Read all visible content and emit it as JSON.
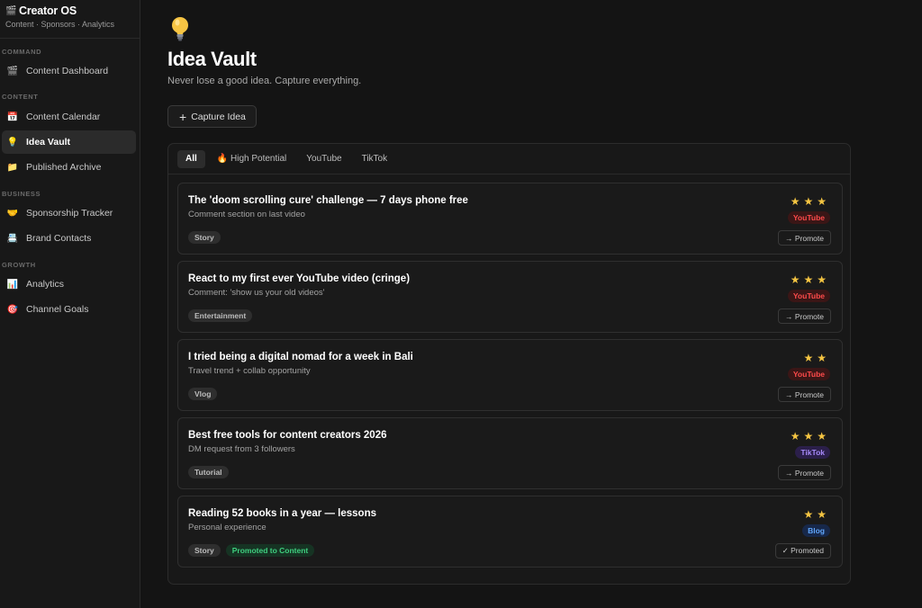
{
  "sidebar": {
    "brand_icon": "clapper-icon",
    "brand_title": "Creator OS",
    "brand_sub": "Content · Sponsors · Analytics",
    "sections": {
      "command": "COMMAND",
      "content": "CONTENT",
      "business": "BUSINESS",
      "growth": "GROWTH"
    },
    "items": [
      {
        "label": "Content Dashboard",
        "icon": "clapper-icon",
        "glyph": "🎬"
      },
      {
        "label": "Content Calendar",
        "icon": "calendar-icon",
        "glyph": "📅"
      },
      {
        "label": "Idea Vault",
        "icon": "lightbulb-icon",
        "glyph": "💡",
        "active": true
      },
      {
        "label": "Published Archive",
        "icon": "folder-icon",
        "glyph": "📁"
      },
      {
        "label": "Sponsorship Tracker",
        "icon": "handshake-icon",
        "glyph": "🤝"
      },
      {
        "label": "Brand Contacts",
        "icon": "contact-card-icon",
        "glyph": "📇"
      },
      {
        "label": "Analytics",
        "icon": "bar-chart-icon",
        "glyph": "📊"
      },
      {
        "label": "Channel Goals",
        "icon": "target-icon",
        "glyph": "🎯"
      }
    ]
  },
  "main": {
    "title": "Idea Vault",
    "subtitle": "Never lose a good idea. Capture everything.",
    "capture_label": "Capture Idea",
    "filters": [
      "All",
      "🔥 High Potential",
      "YouTube",
      "TikTok"
    ],
    "active_filter": "All",
    "ideas": [
      {
        "title": "The 'doom scrolling cure' challenge — 7 days phone free",
        "source": "Comment section on last video",
        "tags": [
          "Story"
        ],
        "rating": 3,
        "stars": "★★★",
        "platform": "YouTube",
        "action": "→ Promote"
      },
      {
        "title": "React to my first ever YouTube video (cringe)",
        "source": "Comment: 'show us your old videos'",
        "tags": [
          "Entertainment"
        ],
        "rating": 3,
        "stars": "★★★",
        "platform": "YouTube",
        "action": "→ Promote"
      },
      {
        "title": "I tried being a digital nomad for a week in Bali",
        "source": "Travel trend + collab opportunity",
        "tags": [
          "Vlog"
        ],
        "rating": 2,
        "stars": "★★",
        "platform": "YouTube",
        "action": "→ Promote"
      },
      {
        "title": "Best free tools for content creators 2026",
        "source": "DM request from 3 followers",
        "tags": [
          "Tutorial"
        ],
        "rating": 3,
        "stars": "★★★",
        "platform": "TikTok",
        "action": "→ Promote"
      },
      {
        "title": "Reading 52 books in a year — lessons",
        "source": "Personal experience",
        "tags": [
          "Story"
        ],
        "status_tag": "Promoted to Content",
        "rating": 2,
        "stars": "★★",
        "platform": "Blog",
        "action": "✓ Promoted"
      }
    ]
  },
  "colors": {
    "youtube_bg": "#3a1616",
    "youtube_fg": "#ff4b4b",
    "tiktok_bg": "#2b1f4a",
    "tiktok_fg": "#a78bfa",
    "blog_bg": "#17284a",
    "blog_fg": "#60a5fa",
    "star": "#f5c542",
    "promoted_green": "#3fcf7f"
  }
}
